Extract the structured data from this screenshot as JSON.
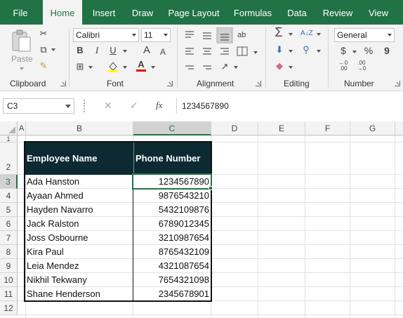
{
  "ribbon_tabs": [
    "File",
    "Home",
    "Insert",
    "Draw",
    "Page Layout",
    "Formulas",
    "Data",
    "Review",
    "View"
  ],
  "active_tab": "Home",
  "groups": {
    "clipboard": {
      "label": "Clipboard",
      "paste": "Paste"
    },
    "font": {
      "label": "Font",
      "font_name": "Calibri",
      "font_size": "11",
      "bold": "B",
      "italic": "I",
      "underline": "U",
      "grow": "A",
      "shrink": "A"
    },
    "alignment": {
      "label": "Alignment"
    },
    "editing": {
      "label": "Editing"
    },
    "number": {
      "label": "Number",
      "format": "General",
      "currency": "$",
      "percent": "%",
      "comma": "9"
    }
  },
  "formula_bar": {
    "name_box": "C3",
    "cancel": "✕",
    "enter": "✓",
    "fx": "fx",
    "value": "1234567890"
  },
  "columns": [
    "A",
    "B",
    "C",
    "D",
    "E",
    "F",
    "G"
  ],
  "selected_column": "C",
  "rows": [
    "1",
    "2",
    "3",
    "4",
    "5",
    "6",
    "7",
    "8",
    "9",
    "10",
    "11",
    "12"
  ],
  "selected_row": "3",
  "table": {
    "headers": [
      "Employee Name",
      "Phone Number"
    ],
    "rows": [
      [
        "Ada Hanston",
        "1234567890"
      ],
      [
        "Ayaan Ahmed",
        "9876543210"
      ],
      [
        "Hayden Navarro",
        "5432109876"
      ],
      [
        "Jack Ralston",
        "6789012345"
      ],
      [
        "Joss Osbourne",
        "3210987654"
      ],
      [
        "Kira Paul",
        "8765432109"
      ],
      [
        "Leia Mendez",
        "4321087654"
      ],
      [
        "Nikhil Tekwany",
        "7654321098"
      ],
      [
        "Shane Henderson",
        "2345678901"
      ]
    ]
  },
  "colors": {
    "accent": "#217346",
    "header_fill": "#0d2a33"
  }
}
